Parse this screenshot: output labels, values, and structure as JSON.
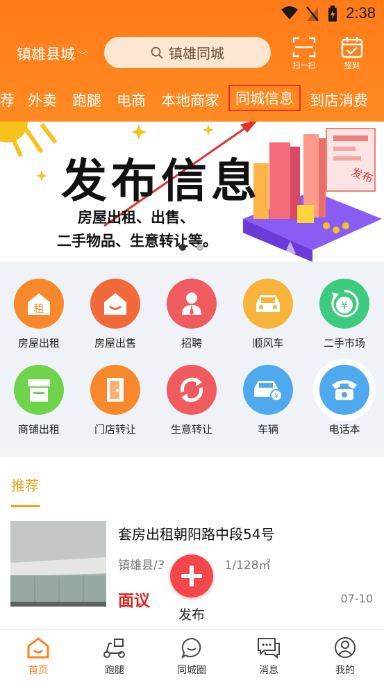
{
  "status": {
    "time": "2:38"
  },
  "header": {
    "city": "镇雄县城",
    "search_placeholder": "镇雄同城",
    "scan_label": "扫一扫",
    "checkin_label": "签到"
  },
  "categories": [
    "荐",
    "外卖",
    "跑腿",
    "电商",
    "本地商家",
    "同城信息",
    "到店消费"
  ],
  "banner": {
    "title": "发布信息",
    "line1": "房屋出租、出售、",
    "line2": "二手物品、生意转让等。",
    "badge": "发布"
  },
  "services": [
    {
      "label": "房屋出租",
      "icon": "house-rent-icon",
      "color": "#f7882c",
      "glyph": "租"
    },
    {
      "label": "房屋出售",
      "icon": "house-sale-icon",
      "color": "#f26a3b",
      "glyph": ""
    },
    {
      "label": "招聘",
      "icon": "recruit-icon",
      "color": "#f05b5f",
      "glyph": ""
    },
    {
      "label": "顺风车",
      "icon": "carpool-icon",
      "color": "#f6b43a",
      "glyph": ""
    },
    {
      "label": "二手市场",
      "icon": "secondhand-icon",
      "color": "#3fcb7f",
      "glyph": "¥"
    },
    {
      "label": "商铺出租",
      "icon": "shop-rent-icon",
      "color": "#6fd34c",
      "glyph": ""
    },
    {
      "label": "门店转让",
      "icon": "store-transfer-icon",
      "color": "#f7882c",
      "glyph": ""
    },
    {
      "label": "生意转让",
      "icon": "business-transfer-icon",
      "color": "#f05b5f",
      "glyph": ""
    },
    {
      "label": "车辆",
      "icon": "vehicle-icon",
      "color": "#4fa9ee",
      "glyph": ""
    },
    {
      "label": "电话本",
      "icon": "phonebook-icon",
      "color": "#4fa9ee",
      "glyph": ""
    }
  ],
  "recommend": {
    "title": "推荐",
    "item": {
      "title": "套房出租朝阳路中段54号",
      "meta": "镇雄县/3",
      "meta_tail": "1/128㎡",
      "price": "面议",
      "date": "07-10"
    }
  },
  "publish_label": "发布",
  "tabs": [
    {
      "label": "首页",
      "icon": "home-icon",
      "active": true
    },
    {
      "label": "跑腿",
      "icon": "scooter-icon",
      "active": false
    },
    {
      "label": "同城圈",
      "icon": "chat-bubble-icon",
      "active": false
    },
    {
      "label": "消息",
      "icon": "message-icon",
      "active": false
    },
    {
      "label": "我的",
      "icon": "profile-icon",
      "active": false
    }
  ],
  "colors": {
    "brand": "#ff7f1e",
    "accent": "#f0a218",
    "price": "#e2231a",
    "highlight_box": "#e4312a"
  }
}
